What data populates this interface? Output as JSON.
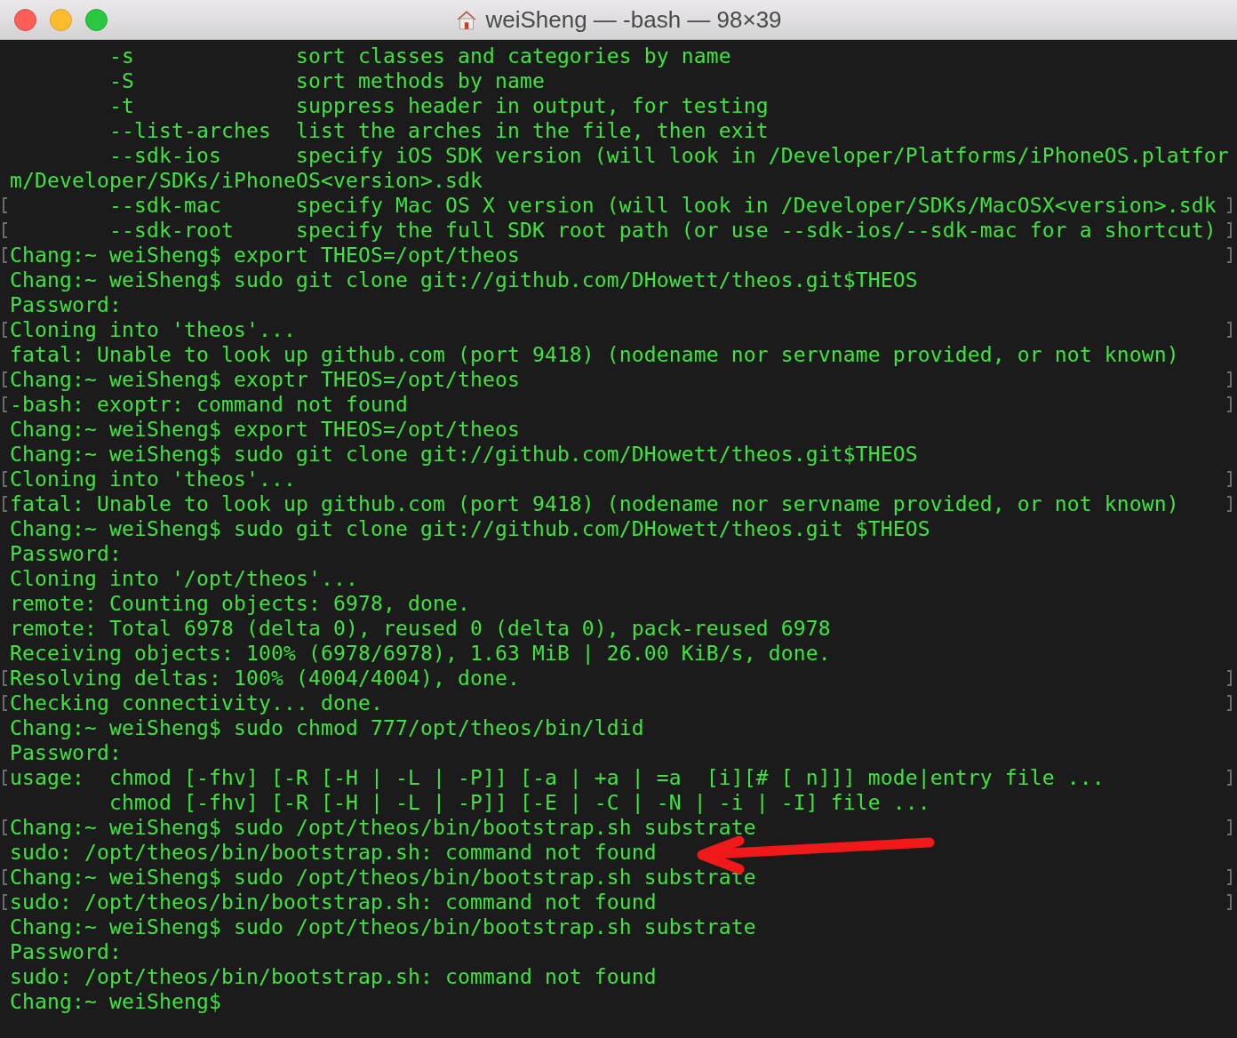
{
  "window": {
    "title": "weiSheng — -bash — 98×39"
  },
  "lines": [
    {
      "text": "        -s             sort classes and categories by name",
      "marked": false
    },
    {
      "text": "        -S             sort methods by name",
      "marked": false
    },
    {
      "text": "        -t             suppress header in output, for testing",
      "marked": false
    },
    {
      "text": "        --list-arches  list the arches in the file, then exit",
      "marked": false
    },
    {
      "text": "        --sdk-ios      specify iOS SDK version (will look in /Developer/Platforms/iPhoneOS.platfor",
      "marked": false
    },
    {
      "text": "m/Developer/SDKs/iPhoneOS<version>.sdk",
      "marked": false
    },
    {
      "text": "        --sdk-mac      specify Mac OS X version (will look in /Developer/SDKs/MacOSX<version>.sdk",
      "marked": true
    },
    {
      "text": "        --sdk-root     specify the full SDK root path (or use --sdk-ios/--sdk-mac for a shortcut)",
      "marked": true
    },
    {
      "text": "Chang:~ weiSheng$ export THEOS=/opt/theos",
      "marked": true
    },
    {
      "text": "Chang:~ weiSheng$ sudo git clone git://github.com/DHowett/theos.git$THEOS",
      "marked": false
    },
    {
      "text": "Password:",
      "marked": false
    },
    {
      "text": "Cloning into 'theos'...",
      "marked": true
    },
    {
      "text": "fatal: Unable to look up github.com (port 9418) (nodename nor servname provided, or not known)",
      "marked": false
    },
    {
      "text": "Chang:~ weiSheng$ exoptr THEOS=/opt/theos",
      "marked": true
    },
    {
      "text": "-bash: exoptr: command not found",
      "marked": true
    },
    {
      "text": "Chang:~ weiSheng$ export THEOS=/opt/theos",
      "marked": false
    },
    {
      "text": "Chang:~ weiSheng$ sudo git clone git://github.com/DHowett/theos.git$THEOS",
      "marked": false
    },
    {
      "text": "Cloning into 'theos'...",
      "marked": true
    },
    {
      "text": "fatal: Unable to look up github.com (port 9418) (nodename nor servname provided, or not known)",
      "marked": true
    },
    {
      "text": "Chang:~ weiSheng$ sudo git clone git://github.com/DHowett/theos.git $THEOS",
      "marked": false
    },
    {
      "text": "Password:",
      "marked": false
    },
    {
      "text": "Cloning into '/opt/theos'...",
      "marked": false
    },
    {
      "text": "remote: Counting objects: 6978, done.",
      "marked": false
    },
    {
      "text": "remote: Total 6978 (delta 0), reused 0 (delta 0), pack-reused 6978",
      "marked": false
    },
    {
      "text": "Receiving objects: 100% (6978/6978), 1.63 MiB | 26.00 KiB/s, done.",
      "marked": false
    },
    {
      "text": "Resolving deltas: 100% (4004/4004), done.",
      "marked": true
    },
    {
      "text": "Checking connectivity... done.",
      "marked": true
    },
    {
      "text": "Chang:~ weiSheng$ sudo chmod 777/opt/theos/bin/ldid",
      "marked": false
    },
    {
      "text": "Password:",
      "marked": false
    },
    {
      "text": "usage:  chmod [-fhv] [-R [-H | -L | -P]] [-a | +a | =a  [i][# [ n]]] mode|entry file ...",
      "marked": true
    },
    {
      "text": "        chmod [-fhv] [-R [-H | -L | -P]] [-E | -C | -N | -i | -I] file ...",
      "marked": false
    },
    {
      "text": "Chang:~ weiSheng$ sudo /opt/theos/bin/bootstrap.sh substrate",
      "marked": true
    },
    {
      "text": "sudo: /opt/theos/bin/bootstrap.sh: command not found",
      "marked": false
    },
    {
      "text": "Chang:~ weiSheng$ sudo /opt/theos/bin/bootstrap.sh substrate",
      "marked": true
    },
    {
      "text": "sudo: /opt/theos/bin/bootstrap.sh: command not found",
      "marked": true
    },
    {
      "text": "Chang:~ weiSheng$ sudo /opt/theos/bin/bootstrap.sh substrate",
      "marked": false
    },
    {
      "text": "Password:",
      "marked": false
    },
    {
      "text": "sudo: /opt/theos/bin/bootstrap.sh: command not found",
      "marked": false
    },
    {
      "text": "Chang:~ weiSheng$",
      "marked": false
    }
  ]
}
